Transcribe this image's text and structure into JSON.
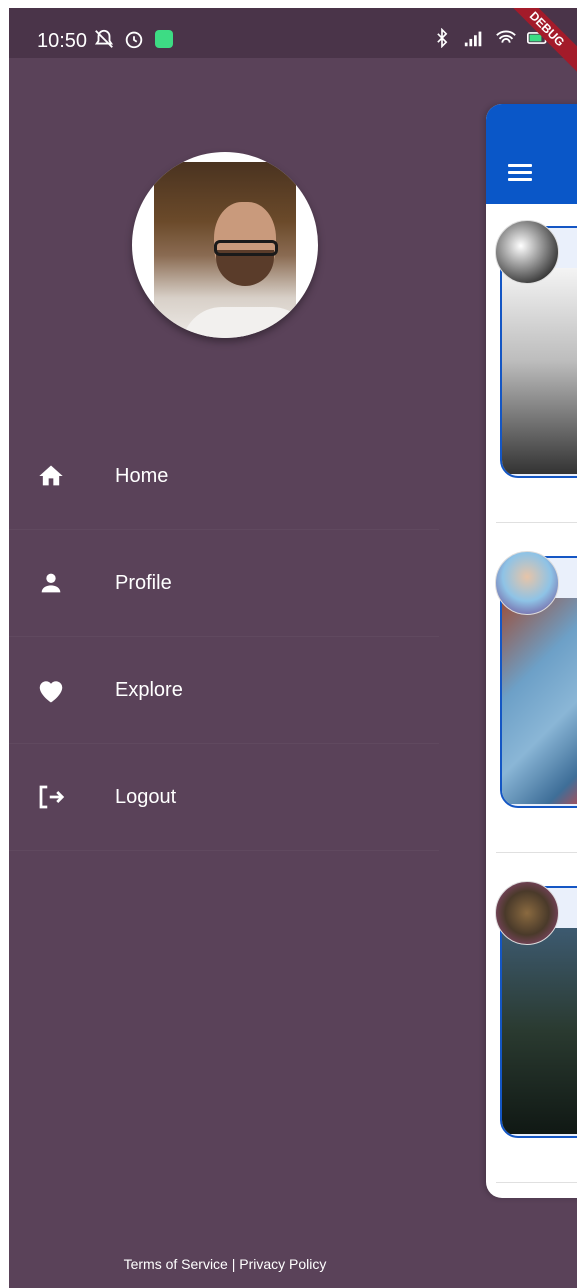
{
  "status_bar": {
    "time": "10:50",
    "left_icons": [
      "muted-notification-icon",
      "alarm-icon",
      "android-icon"
    ],
    "right_icons": [
      "bluetooth-icon",
      "signal-icon",
      "wifi-icon",
      "battery-icon"
    ],
    "debug_label": "DEBUG"
  },
  "drawer": {
    "background_color": "#5a4259",
    "menu_items": [
      {
        "label": "Home",
        "icon": "home-icon"
      },
      {
        "label": "Profile",
        "icon": "person-icon"
      },
      {
        "label": "Explore",
        "icon": "heart-icon"
      },
      {
        "label": "Logout",
        "icon": "logout-icon"
      }
    ],
    "footer": "Terms of Service | Privacy Policy"
  },
  "background_screen": {
    "appbar_color": "#0a57c8",
    "posts": 3
  }
}
